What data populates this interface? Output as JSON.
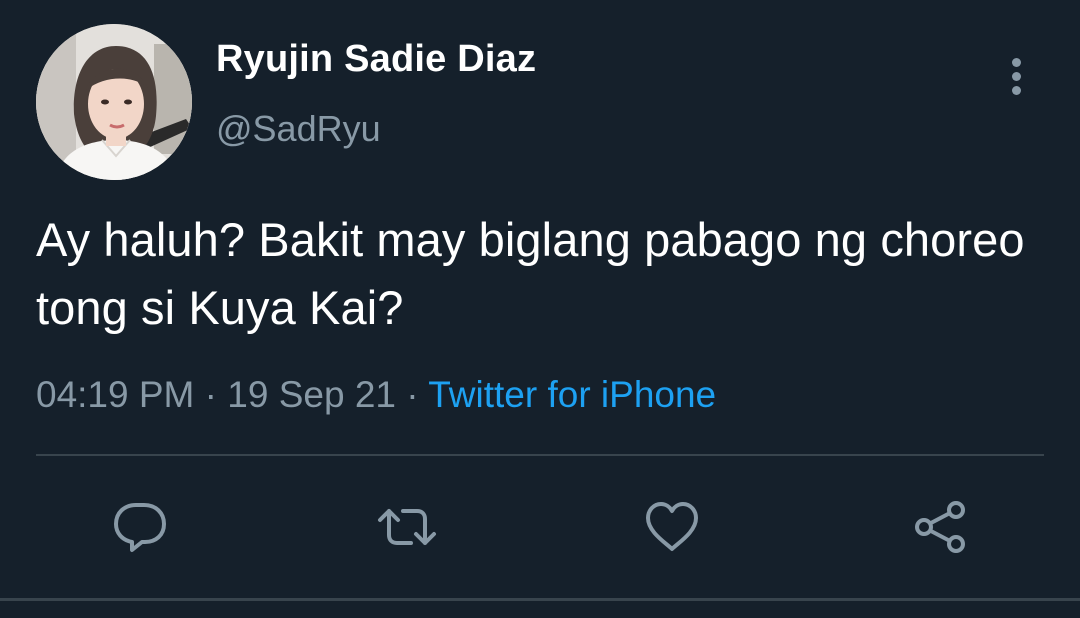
{
  "tweet": {
    "display_name": "Ryujin Sadie Diaz",
    "handle": "@SadRyu",
    "text": "Ay haluh? Bakit may biglang pabago ng choreo tong si Kuya Kai?",
    "time": "04:19 PM",
    "separator": "·",
    "date": "19 Sep 21",
    "source": "Twitter for iPhone"
  },
  "icons": {
    "more": "more-vertical-icon",
    "reply": "reply-icon",
    "retweet": "retweet-icon",
    "like": "heart-icon",
    "share": "share-icon"
  },
  "colors": {
    "background": "#15202b",
    "primary_text": "#ffffff",
    "secondary_text": "#8899a6",
    "link": "#1da1f2",
    "divider": "#38444d"
  }
}
